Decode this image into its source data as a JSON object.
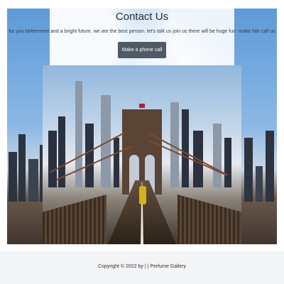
{
  "header": {
    "title": "Contact Us",
    "subtitle": "for you betterment and a bright future. we are the best person. let's talk us join us there will be huge fun. make hile call us",
    "call_button_label": "Make a phone call"
  },
  "hero": {
    "image_subject": "city skyline and bridge walkway"
  },
  "footer": {
    "copyright": "Copyright © 2022 by | | Perfume Gallery"
  },
  "colors": {
    "button_bg": "#4f5a66",
    "footer_bg": "#f3f4f6"
  }
}
